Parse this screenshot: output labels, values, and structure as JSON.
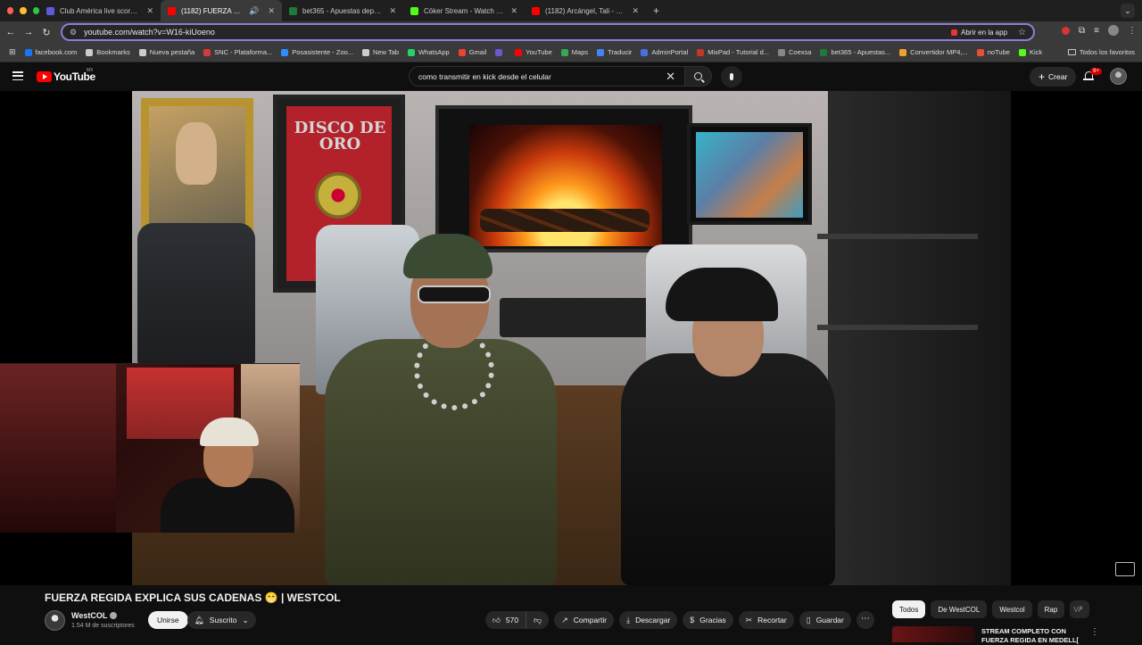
{
  "browser": {
    "tabs": [
      {
        "title": "Club América live score, sche",
        "color": "#5b5bd6",
        "active": false
      },
      {
        "title": "(1182) FUERZA REGIDA E",
        "color": "#ff0000",
        "active": true
      },
      {
        "title": "bet365 - Apuestas deportiva",
        "color": "#1e7a3a",
        "active": false
      },
      {
        "title": "Cōker Stream - Watch Live o",
        "color": "#53fc18",
        "active": false
      },
      {
        "title": "(1182) Arcángel, Tali - Flow C",
        "color": "#ff0000",
        "active": false
      }
    ],
    "new_tab": "+",
    "url": "youtube.com/watch?v=W16-kiUoeno",
    "open_in_app": "Abrir en la app",
    "bookmarks": [
      {
        "label": "facebook.com",
        "color": "#1877f2"
      },
      {
        "label": "Bookmarks",
        "color": "#cccccc"
      },
      {
        "label": "Nueva pestaña",
        "color": "#cccccc"
      },
      {
        "label": "SNC - Plataforma...",
        "color": "#d33b3b"
      },
      {
        "label": "Posasistente - Zoo...",
        "color": "#2d8cff"
      },
      {
        "label": "New Tab",
        "color": "#cccccc"
      },
      {
        "label": "WhatsApp",
        "color": "#25d366"
      },
      {
        "label": "Gmail",
        "color": "#ea4335"
      },
      {
        "label": "",
        "color": "#6a5acd"
      },
      {
        "label": "YouTube",
        "color": "#ff0000"
      },
      {
        "label": "Maps",
        "color": "#34a853"
      },
      {
        "label": "Traducir",
        "color": "#4285f4"
      },
      {
        "label": "AdminPortal",
        "color": "#4a6ee0"
      },
      {
        "label": "MixPad - Tutorial d...",
        "color": "#c0392b"
      },
      {
        "label": "Coexsa",
        "color": "#888888"
      },
      {
        "label": "bet365 - Apuestas...",
        "color": "#1e7a3a"
      },
      {
        "label": "Convertidor MP4,...",
        "color": "#f0a030"
      },
      {
        "label": "noTube",
        "color": "#e74c3c"
      },
      {
        "label": "Kick",
        "color": "#53fc18"
      }
    ],
    "all_bookmarks": "Todos los favoritos"
  },
  "youtube": {
    "logo": "YouTube",
    "country": "MX",
    "search_query": "como transmitir en kick desde el celular",
    "create_label": "Crear",
    "notif_badge": "9+",
    "video": {
      "title": "FUERZA REGIDA EXPLICA SUS CADENAS 😁 | WESTCOL",
      "channel": "WestCOL",
      "subscribers": "1.54 M de suscriptores",
      "join_label": "Unirse",
      "subscribed_label": "Suscrito",
      "likes": "570",
      "share_label": "Compartir",
      "download_label": "Descargar",
      "thanks_label": "Gracias",
      "clip_label": "Recortar",
      "save_label": "Guardar",
      "more_label": "⋯"
    },
    "frame_text": {
      "plaque": "DISCO DE ORO"
    },
    "chips": [
      "Todos",
      "De WestCOL",
      "Westcol",
      "Rap",
      "Vi"
    ],
    "recommendation": {
      "title": "STREAM COMPLETO CON FUERZA REGIDA EN MEDELL["
    }
  }
}
